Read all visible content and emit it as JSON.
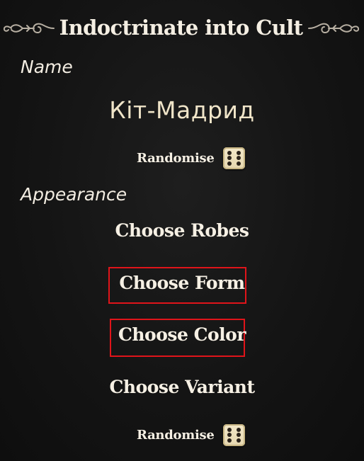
{
  "header": {
    "title": "Indoctrinate into Cult"
  },
  "sections": {
    "name_label": "Name",
    "appearance_label": "Appearance"
  },
  "follower": {
    "name": "Кіт-Мадрид"
  },
  "name_randomise": {
    "label": "Randomise",
    "icon": "dice-icon"
  },
  "appearance": {
    "options": [
      {
        "label": "Choose Robes"
      },
      {
        "label": "Choose Form",
        "highlighted": true
      },
      {
        "label": "Choose Color",
        "highlighted": true
      },
      {
        "label": "Choose Variant"
      }
    ],
    "randomise_label": "Randomise"
  },
  "colors": {
    "background": "#141414",
    "text": "#f5efe3",
    "name_text": "#efe4c8",
    "highlight_box": "#e0141a",
    "dice": "#efe2bf"
  }
}
